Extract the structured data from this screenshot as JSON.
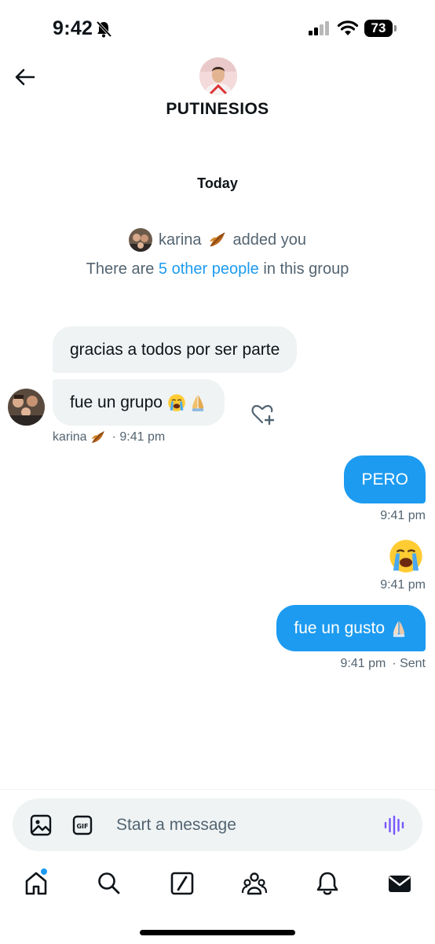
{
  "status_bar": {
    "time": "9:42",
    "battery": "73"
  },
  "header": {
    "group_name": "PUTINESIOS"
  },
  "conversation": {
    "date_separator": "Today",
    "system": {
      "actor": "karina",
      "action": "added you",
      "others_prefix": "There are",
      "others_link": "5 other people",
      "others_suffix": "in this group"
    },
    "messages": [
      {
        "direction": "incoming",
        "text": "gracias a todos por ser parte"
      },
      {
        "direction": "incoming",
        "text": "fue un grupo",
        "emojis": [
          "loudly-crying-face",
          "folded-hands"
        ],
        "sender": "karina",
        "time": "9:41 pm"
      },
      {
        "direction": "outgoing",
        "text": "PERO",
        "time": "9:41 pm"
      },
      {
        "direction": "outgoing",
        "emoji_only": "loudly-crying-face",
        "time": "9:41 pm"
      },
      {
        "direction": "outgoing",
        "text": "fue un gusto",
        "emojis": [
          "folded-hands"
        ],
        "time": "9:41 pm",
        "status": "· Sent"
      }
    ]
  },
  "composer": {
    "placeholder": "Start a message"
  },
  "colors": {
    "accent": "#1d9bf0",
    "bubble_incoming": "#eff3f4",
    "secondary_text": "#536471"
  },
  "nav": [
    "home-icon",
    "search-icon",
    "grok-icon",
    "communities-icon",
    "notifications-icon",
    "messages-icon"
  ]
}
